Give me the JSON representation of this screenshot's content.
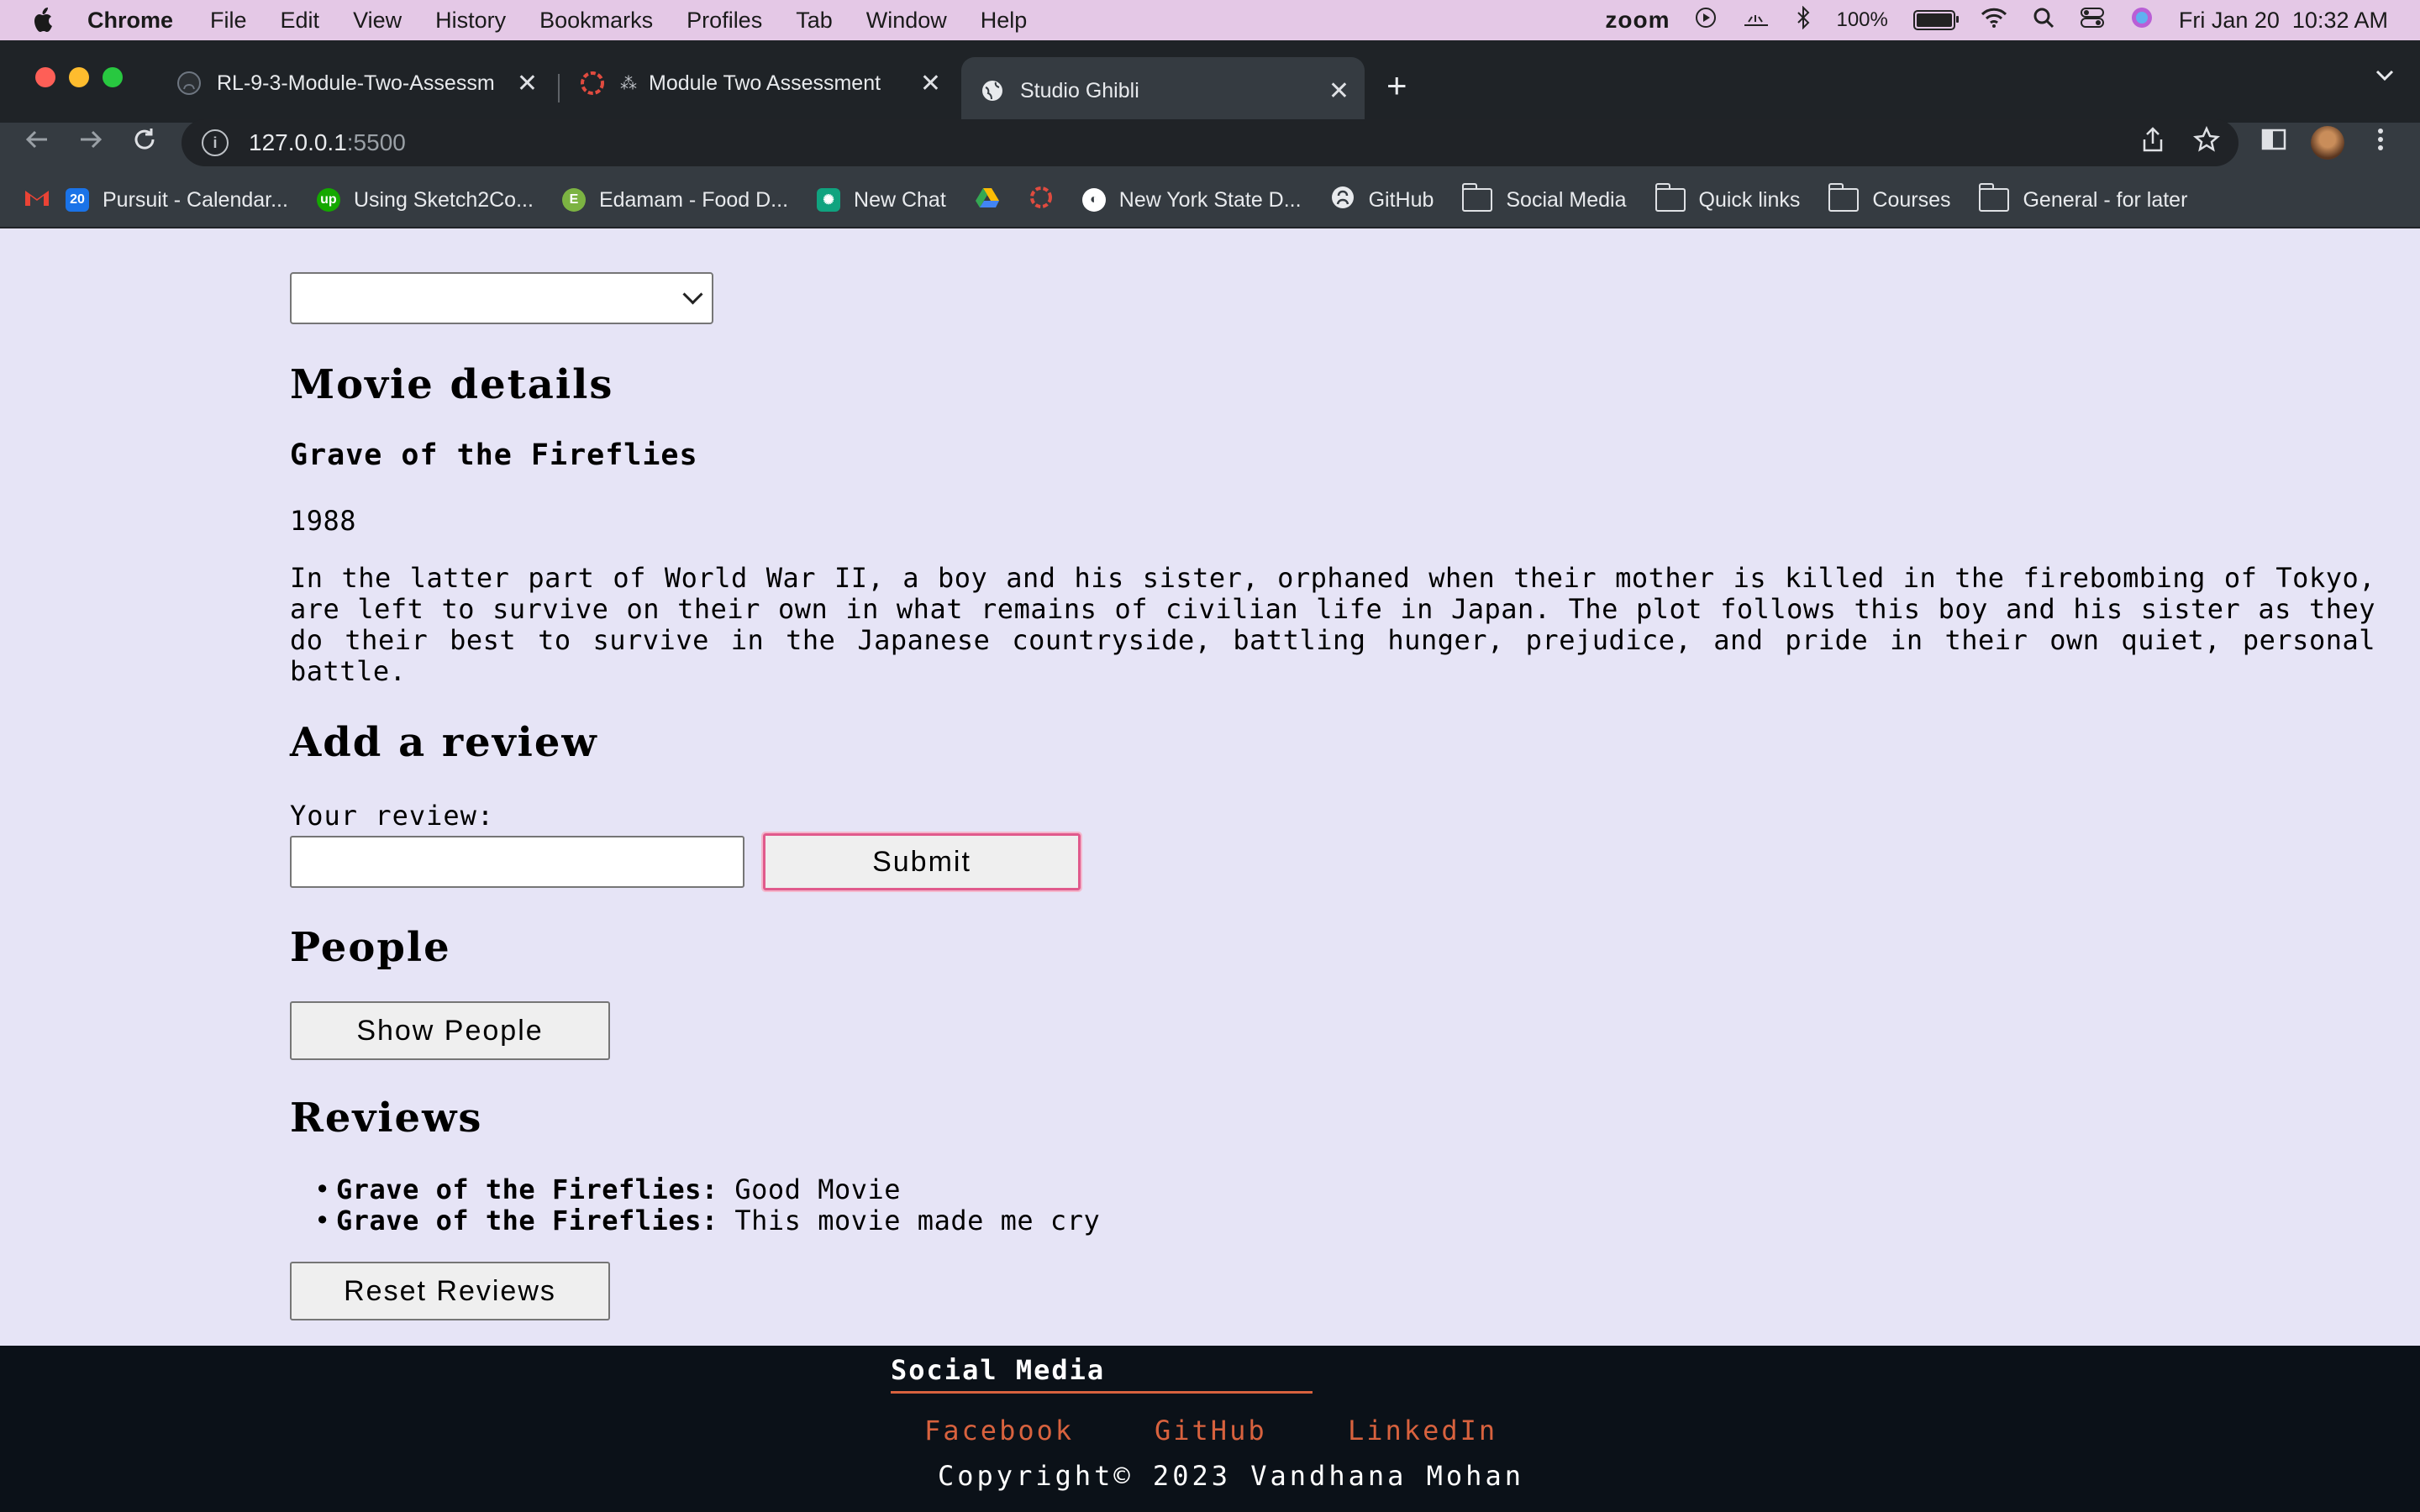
{
  "menubar": {
    "app": "Chrome",
    "items": [
      "File",
      "Edit",
      "View",
      "History",
      "Bookmarks",
      "Profiles",
      "Tab",
      "Window",
      "Help"
    ],
    "zoom": "zoom",
    "battery": "100%",
    "datetime": "Fri Jan 20  10:32 AM"
  },
  "tabs": [
    {
      "title": "RL-9-3-Module-Two-Assessm",
      "icon": "github-icon"
    },
    {
      "title": "Module Two Assessment",
      "icon": "pursuit-icon"
    },
    {
      "title": "Studio Ghibli",
      "icon": "globe-icon"
    }
  ],
  "address": {
    "host": "127.0.0.1",
    "port": ":5500"
  },
  "bookmarks": [
    {
      "label": "Pursuit - Calendar...",
      "icon": "calendar-icon",
      "color": "#1a73e8"
    },
    {
      "label": "Using Sketch2Co...",
      "icon": "upwork-icon",
      "color": "#14a800"
    },
    {
      "label": "Edamam - Food D...",
      "icon": "edamam-icon",
      "color": "#7cb342"
    },
    {
      "label": "New Chat",
      "icon": "openai-icon",
      "color": "#10a37f"
    },
    {
      "label": "",
      "icon": "drive-icon",
      "color": "#fbbc04"
    },
    {
      "label": "",
      "icon": "pursuit-icon",
      "color": "#e04b3f"
    },
    {
      "label": "New York State D...",
      "icon": "globe-icon",
      "color": "#ffffff"
    },
    {
      "label": "GitHub",
      "icon": "github-icon",
      "color": "#ffffff"
    },
    {
      "label": "Social Media",
      "icon": "folder-icon",
      "color": "#dfe1e5"
    },
    {
      "label": "Quick links",
      "icon": "folder-icon",
      "color": "#dfe1e5"
    },
    {
      "label": "Courses",
      "icon": "folder-icon",
      "color": "#dfe1e5"
    },
    {
      "label": "General - for later",
      "icon": "folder-icon",
      "color": "#dfe1e5"
    }
  ],
  "page": {
    "movie_details_heading": "Movie details",
    "movie_title": "Grave of the Fireflies",
    "movie_year": "1988",
    "movie_description": "In the latter part of World War II, a boy and his sister, orphaned when their mother is killed in the firebombing of Tokyo, are left to survive on their own in what remains of civilian life in Japan. The plot follows this boy and his sister as they do their best to survive in the Japanese countryside, battling hunger, prejudice, and pride in their own quiet, personal battle.",
    "add_review_heading": "Add a review",
    "review_label": "Your review:",
    "review_value": "",
    "submit_label": "Submit",
    "people_heading": "People",
    "show_people_label": "Show People",
    "reviews_heading": "Reviews",
    "reviews": [
      {
        "movie": "Grave of the Fireflies:",
        "text": " Good Movie"
      },
      {
        "movie": "Grave of the Fireflies:",
        "text": " This movie made me cry"
      }
    ],
    "reset_label": "Reset Reviews"
  },
  "footer": {
    "social_heading": "Social Media",
    "links": [
      "Facebook",
      "GitHub",
      "LinkedIn"
    ],
    "copyright": "Copyright© 2023 Vandhana Mohan"
  },
  "colors": {
    "page_bg": "#e6e4f6",
    "footer_bg": "#0b1118",
    "accent": "#d8623e",
    "focus": "#e05a8c"
  }
}
